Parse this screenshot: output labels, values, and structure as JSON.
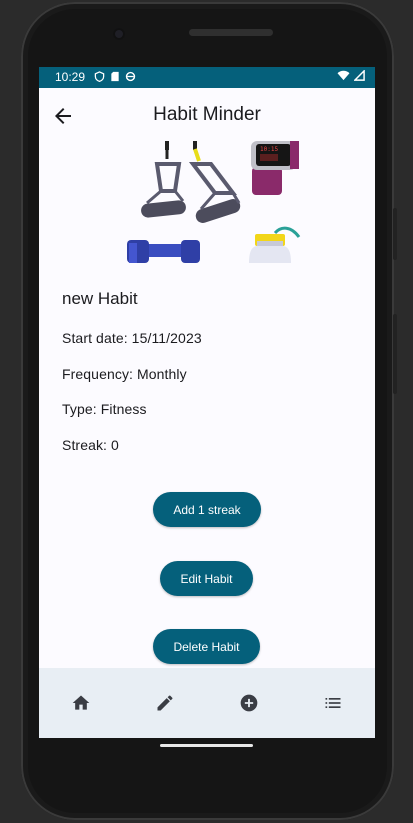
{
  "status_bar": {
    "time": "10:29",
    "icons": [
      "shield-icon",
      "sd-card-icon",
      "sync-icon"
    ],
    "right_icons": [
      "wifi-icon",
      "signal-icon"
    ]
  },
  "app_bar": {
    "title": "Habit Minder",
    "back_icon": "arrow-back-icon"
  },
  "hero_image": {
    "items": [
      "resistance-bands",
      "smartwatch",
      "dumbbell",
      "water-bottle"
    ]
  },
  "habit": {
    "name": "new Habit",
    "start_date": "Start date: 15/11/2023",
    "frequency": "Frequency: Monthly",
    "type": "Type: Fitness",
    "streak": "Streak: 0"
  },
  "actions": {
    "add_streak": "Add 1 streak",
    "edit": "Edit Habit",
    "delete": "Delete Habit"
  },
  "bottom_nav": {
    "items": [
      "home-icon",
      "edit-icon",
      "add-circle-icon",
      "list-icon"
    ]
  },
  "colors": {
    "primary": "#05607b",
    "nav_background": "#e8eef4",
    "screen_background": "#fcfbff"
  }
}
